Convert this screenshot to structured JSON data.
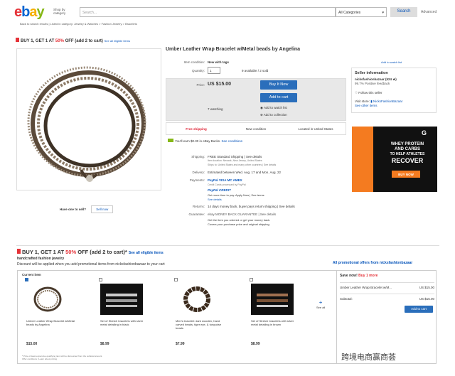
{
  "header": {
    "logo_letters": [
      "e",
      "b",
      "a",
      "y"
    ],
    "logo_colors": [
      "#e53238",
      "#0064d2",
      "#f5af02",
      "#86b817"
    ],
    "shop_by": "Shop by\ncategory",
    "search_placeholder": "Search...",
    "category": "All Categories",
    "search_button": "Search",
    "advanced": "Advanced"
  },
  "breadcrumb": "Back to search results  |  Listed in category:  Jewelry & Watches > Fashion Jewelry > Bracelets",
  "promo": {
    "prefix": "BUY 1, GET 1 AT ",
    "percent": "50%",
    "suffix": " OFF (add 2 to cart)",
    "see": "See all eligible items"
  },
  "item": {
    "title": "Umber Leather Wrap Bracelet w/Metal beads by Angelina",
    "condition_label": "Item condition:",
    "condition": "New with tags",
    "quantity_label": "Quantity:",
    "quantity": "1",
    "available": "9 available / 2 sold",
    "price_label": "Price:",
    "price": "US $15.00",
    "buy_now": "Buy It Now",
    "add_to_cart": "Add to cart",
    "watching": "7 watching",
    "add_watch": "Add to watch list",
    "add_collection": "Add to collection",
    "free_shipping": "Free shipping",
    "new_condition": "New condition",
    "located": "Located in United States",
    "bucks": "You'll earn $0.30 in eBay Bucks.",
    "see_conditions": "See conditions",
    "have_one": "Have one to sell?",
    "sell_now": "Sell now"
  },
  "details": [
    {
      "label": "Shipping:",
      "value": "FREE  Standard Shipping | See details"
    },
    {
      "label": "",
      "value": "Item location: Newark, New Jersey, United States"
    },
    {
      "label": "",
      "value": "Ships to: United States and many other countries | See details"
    },
    {
      "label": "Delivery:",
      "value": "Estimated between Wed. Aug. 17 and Mon. Aug. 22"
    },
    {
      "label": "Payments:",
      "value": "PayPal  VISA  MC  AMEX"
    },
    {
      "label": "",
      "value": "Credit Cards processed by PayPal"
    },
    {
      "label": "",
      "value": "PayPal CREDIT"
    },
    {
      "label": "",
      "value": "Get more time to pay. Apply Now | See terms"
    },
    {
      "label": "",
      "value": "See details"
    },
    {
      "label": "Returns:",
      "value": "14 days money back, buyer pays return shipping | See details"
    },
    {
      "label": "Guarantee:",
      "value": "ebay MONEY BACK GUARANTEE | See details"
    },
    {
      "label": "",
      "value": "Get the item you ordered or get your money back."
    },
    {
      "label": "",
      "value": "Covers your purchase price and original shipping."
    }
  ],
  "seller": {
    "heading": "Seller information",
    "name": "nicksfashionbazaar (524 ★)",
    "feedback": "99.7% Positive feedback",
    "follow": "Follow this seller",
    "store_label": "Visit store:",
    "store": "NicksFashionBazaar",
    "other_items": "See other items",
    "watch_list": "Add to watch list"
  },
  "ad": {
    "line1": "WHEY PROTEIN",
    "line2": "AND CARBS",
    "line3": "TO HELP ATHLETES",
    "line4": "RECOVER",
    "cta": "BUY NOW",
    "brand": "G"
  },
  "section2": {
    "title_prefix": "BUY 1, GET 1 AT ",
    "title_percent": "50%",
    "title_suffix": " OFF (add 2 to cart)*",
    "see": "See all eligible items",
    "sub": "handcrafted fashion jewelry",
    "desc": "Discount will be applied when you add promotional items from nicksfashionbazaar to your cart",
    "all_offers": "All promotional offers from nicksfashionbazaar",
    "current_item": "Current item",
    "see_all": "See all",
    "footnote": "* Price of least expensive qualifying item will be discounted from the subtotal amount.",
    "footnote2": "Offer conditions  |  Learn about pricing"
  },
  "products": [
    {
      "name": "Umber Leather Wrap Bracelet w/Metal beads by Angelina",
      "price": "$15.00"
    },
    {
      "name": "Set of Stretch bracelets with silver metal detailing in black",
      "price": "$8.99"
    },
    {
      "name": "Men's bracelet: dark wooden, hand carved beads, tiger eye, & turquoise beads",
      "price": "$7.99"
    },
    {
      "name": "Set of Stretch bracelets with silver metal detailing in brown",
      "price": "$8.99"
    }
  ],
  "save": {
    "label": "Save now!",
    "buy_more": "Buy 1 more",
    "item": "Umber Leather Wrap Bracelet w/M...",
    "item_price": "US $15.00",
    "subtotal_label": "Subtotal:",
    "subtotal": "US $15.00",
    "add_to_cart": "Add to cart"
  },
  "watermark": "跨境电商赢商荟"
}
